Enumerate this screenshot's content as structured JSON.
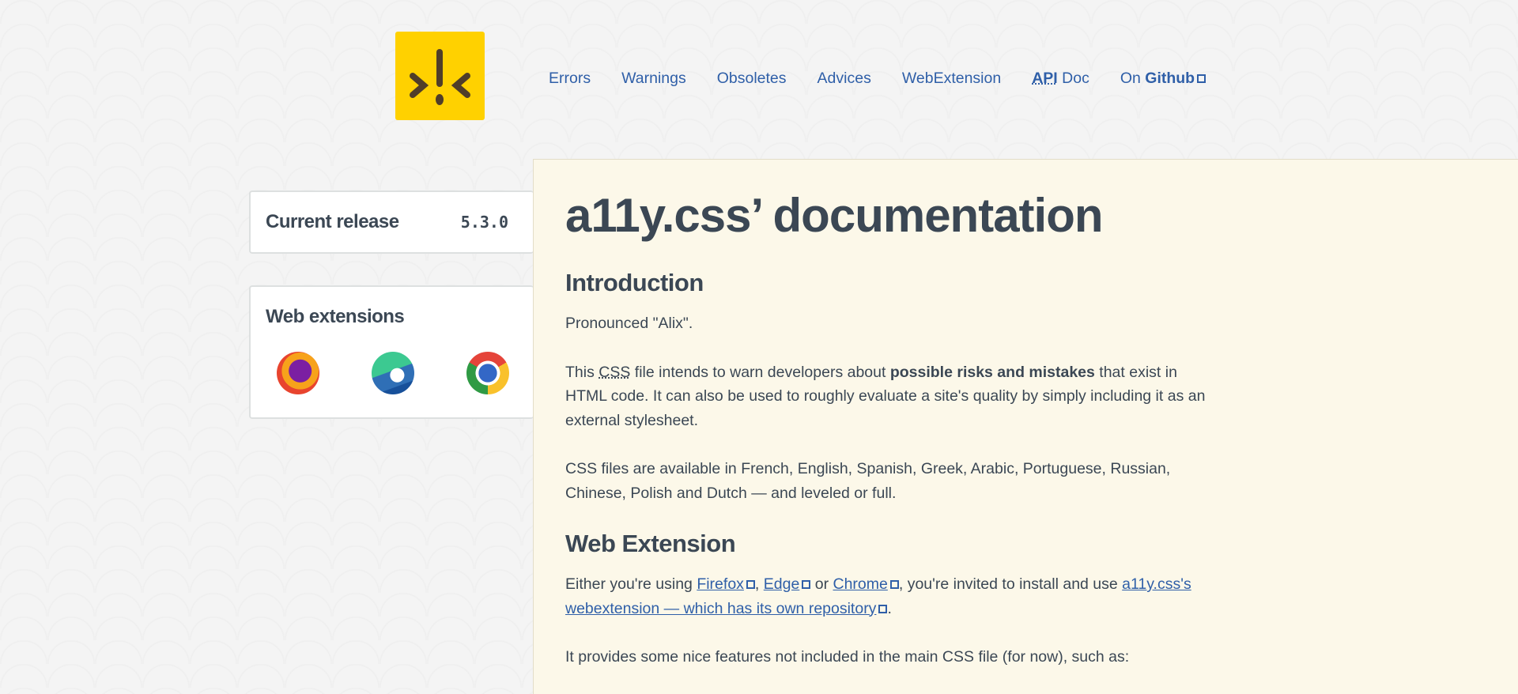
{
  "logo": {
    "alt": ">!<"
  },
  "nav": [
    {
      "label": "Errors"
    },
    {
      "label": "Warnings"
    },
    {
      "label": "Obsoletes"
    },
    {
      "label": "Advices"
    },
    {
      "label": "WebExtension"
    },
    {
      "abbr": "API",
      "label": " Doc"
    },
    {
      "prefix": "On ",
      "label": "Github"
    }
  ],
  "sidebar": {
    "release": {
      "label": "Current release",
      "version": "5.3.0"
    },
    "extensions": {
      "title": "Web extensions",
      "browsers": [
        "firefox",
        "edge",
        "chrome"
      ]
    }
  },
  "main": {
    "title": "a11y.css’ documentation",
    "intro_heading": "Introduction",
    "p1": "Pronounced \"Alix\".",
    "p2_a": "This ",
    "p2_abbr": "CSS",
    "p2_b": " file intends to warn developers about ",
    "p2_strong": "possible risks and mistakes",
    "p2_c": " that exist in HTML code. It can also be used to roughly evaluate a site's quality by simply includ­ing it as an external stylesheet.",
    "p3": "CSS files are available in French, English, Spanish, Greek, Arabic, Portuguese, Russian, Chinese, Polish and Dutch — and leveled or full.",
    "webext_heading": "Web Extension",
    "p4_a": "Either you're using ",
    "firefox": "Firefox",
    "sep1": ", ",
    "edge": "Edge",
    "sep2": " or ",
    "chrome": "Chrome",
    "p4_b": ", you're invited to install and use ",
    "repo": "a11y.css's webextension — which has its own repository",
    "p4_c": ".",
    "p5": "It provides some nice features not included in the main CSS file (for now), such as:"
  }
}
